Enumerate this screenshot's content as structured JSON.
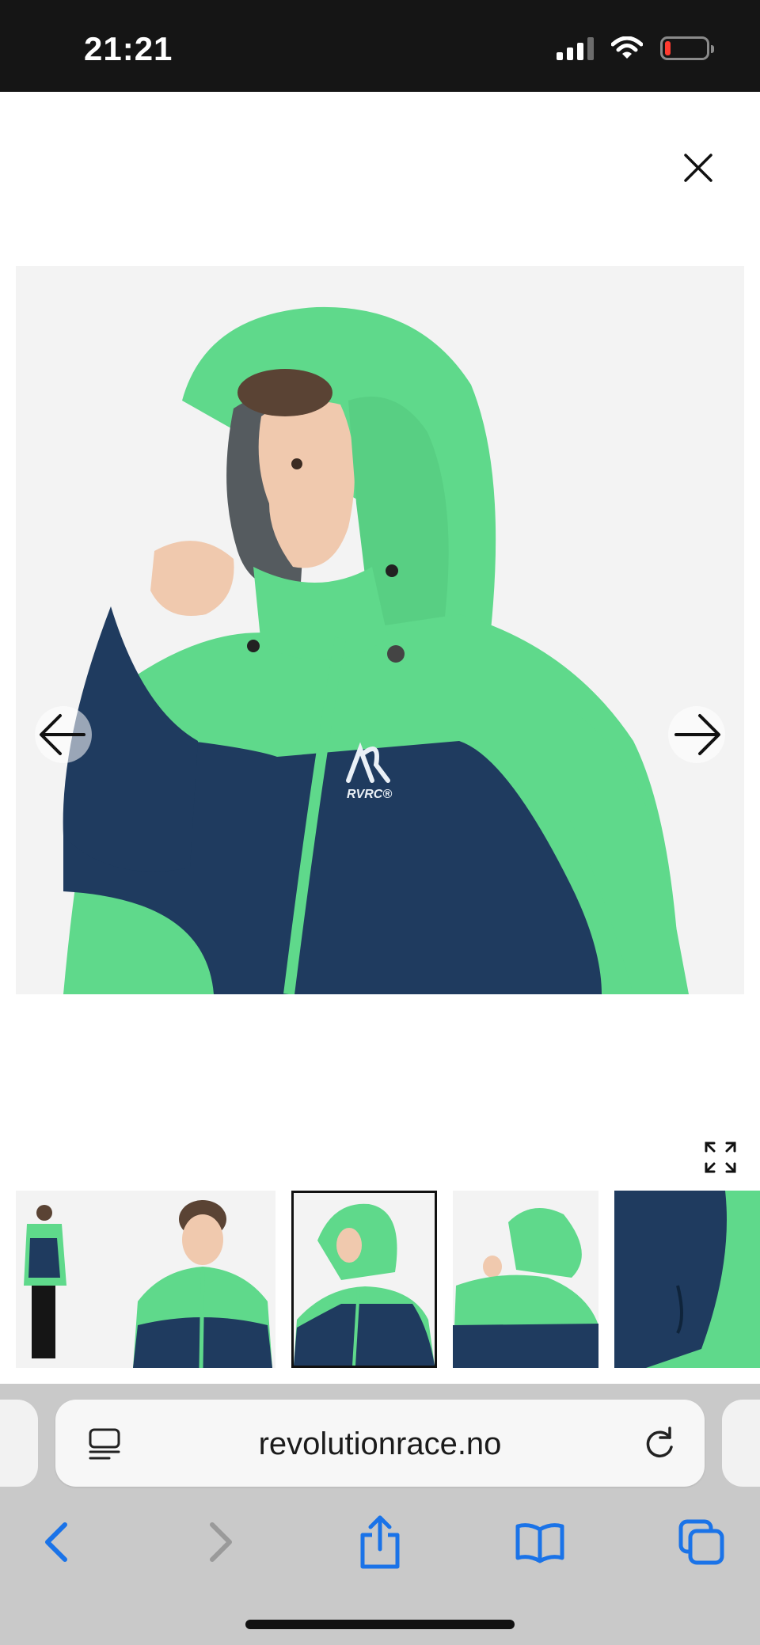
{
  "status_bar": {
    "time": "21:21",
    "icons": [
      "cellular-signal-icon",
      "wifi-icon",
      "battery-low-icon"
    ],
    "battery_color": "#ff3b30"
  },
  "gallery": {
    "close_icon": "close-icon",
    "prev_icon": "arrow-left-icon",
    "next_icon": "arrow-right-icon",
    "expand_icon": "expand-icon",
    "main_image": {
      "brand_text": "RVRC®",
      "jacket_colors": {
        "green": "#5fd98b",
        "navy": "#1f3b5f"
      }
    },
    "thumbnails": [
      {
        "view": "back",
        "selected": false
      },
      {
        "view": "front",
        "selected": false
      },
      {
        "view": "hood-side",
        "selected": true
      },
      {
        "view": "hood-back",
        "selected": false
      },
      {
        "view": "pocket-detail",
        "selected": false
      }
    ]
  },
  "browser": {
    "url": "revolutionrace.no",
    "reader_icon": "reader-mode-icon",
    "reload_icon": "reload-icon",
    "toolbar": [
      "back-icon",
      "forward-icon",
      "share-icon",
      "bookmarks-icon",
      "tabs-icon"
    ],
    "accent": "#1a73e8",
    "disabled": "#9a9a9a"
  }
}
